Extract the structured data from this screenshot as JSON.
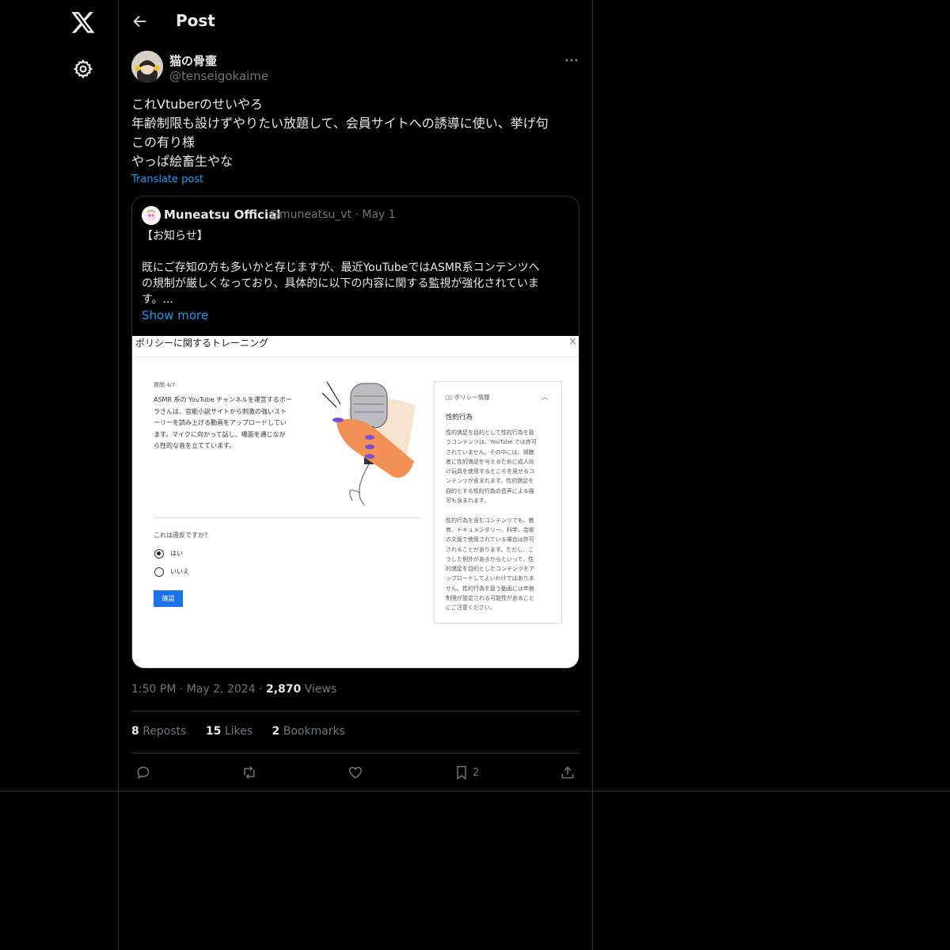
{
  "header": {
    "title": "Post"
  },
  "post": {
    "author_name": "猫の骨壷",
    "author_handle": "@tenseigokaime",
    "text_lines": [
      "これVtuberのせいやろ",
      "年齢制限も設けずやりたい放題して、会員サイトへの誘導に使い、挙げ句",
      "この有り様",
      "やっぱ絵畜生やな"
    ],
    "translate_label": "Translate post",
    "time": "1:50 PM",
    "date": "May 2, 2024",
    "views_count": "2,870",
    "views_label": "Views",
    "reposts_count": "8",
    "reposts_label": "Reposts",
    "likes_count": "15",
    "likes_label": "Likes",
    "bookmarks_count": "2",
    "bookmarks_label": "Bookmarks",
    "bookmark_action_count": "2"
  },
  "quote": {
    "name": "Muneatsu Official",
    "handle": "@muneatsu_vt",
    "date": "May 1",
    "text_lines": [
      "【お知らせ】",
      "",
      "既にご存知の方も多いかと存じますが、最近YouTubeではASMR系コンテンツへ",
      "の規制が厳しくなっており、具体的に以下の内容に関する監視が強化されていま",
      "す。..."
    ],
    "show_more": "Show more",
    "image": {
      "title": "ポリシーに関するトレーニング",
      "close": "×",
      "question_no": "質問 4/7",
      "question_lines": [
        "ASMR 系の YouTube チャンネルを運営するポー",
        "ラさんは、官能小説サイトから刺激の強いスト",
        "ーリーを読み上げる動画をアップロードしてい",
        "ます。マイクに向かって話し、場面を通じなが",
        "ら性的な音を立てています。"
      ],
      "ask": "これは違反ですか？",
      "option_yes": "はい",
      "option_no": "いいえ",
      "confirm": "確認",
      "policy_head": "ポリシー情報",
      "policy_sub": "性的行為",
      "policy_lines": [
        "性的満足を目的として性的行為を扱",
        "うコンテンツは、YouTube では許可",
        "されていません。その中には、視聴",
        "者に性的満足を与えるために成人向",
        "け玩具を使用するところを見せるコ",
        "ンテンツが含まれます。性的満足を",
        "目的とする性的行為の音声による描",
        "写も含まれます。",
        "",
        "性的行為を含むコンテンツでも、教",
        "育、ドキュメンタリー、科学、芸術",
        "の文脈で使用されている場合は許可",
        "されることがあります。ただし、こ",
        "うした例外があるからといって、性",
        "的満足を目的としたコンテンツをア",
        "ップロードしてよいわけではありま",
        "せん。性的行為を扱う動画には年齢",
        "制限が設定される可能性があること",
        "にご注意ください。"
      ]
    }
  },
  "colors": {
    "background": "#000000",
    "text": "#e7e9ea",
    "muted": "#71767b",
    "link": "#1d9bf0",
    "border": "#2f3336"
  },
  "icons": [
    "x-logo-icon",
    "gear-icon",
    "back-arrow-icon",
    "more-icon",
    "reply-icon",
    "repost-icon",
    "like-icon",
    "bookmark-icon",
    "share-icon"
  ]
}
